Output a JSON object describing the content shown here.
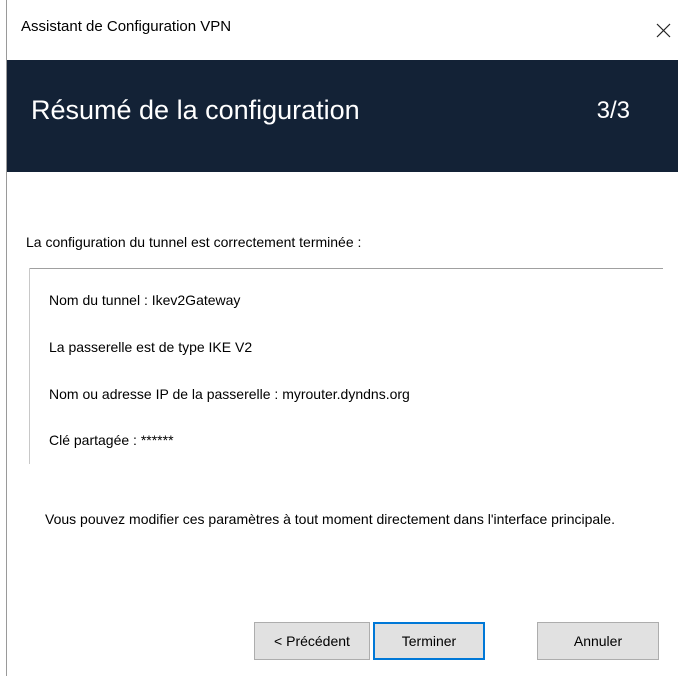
{
  "window": {
    "title": "Assistant de Configuration VPN"
  },
  "header": {
    "title": "Résumé de la configuration",
    "step": "3/3",
    "background_color": "#132236"
  },
  "content": {
    "intro": "La configuration du tunnel est correctement terminée :",
    "summary": [
      "Nom du tunnel : Ikev2Gateway",
      "La passerelle est de type IKE V2",
      "Nom ou adresse IP de la passerelle : myrouter.dyndns.org",
      "Clé partagée : ******"
    ],
    "note": "Vous pouvez modifier ces paramètres à tout moment directement dans l'interface principale."
  },
  "buttons": {
    "previous": "< Précédent",
    "finish": "Terminer",
    "cancel": "Annuler",
    "focus_color": "#0078d7"
  },
  "icons": {
    "close": "close-icon"
  }
}
